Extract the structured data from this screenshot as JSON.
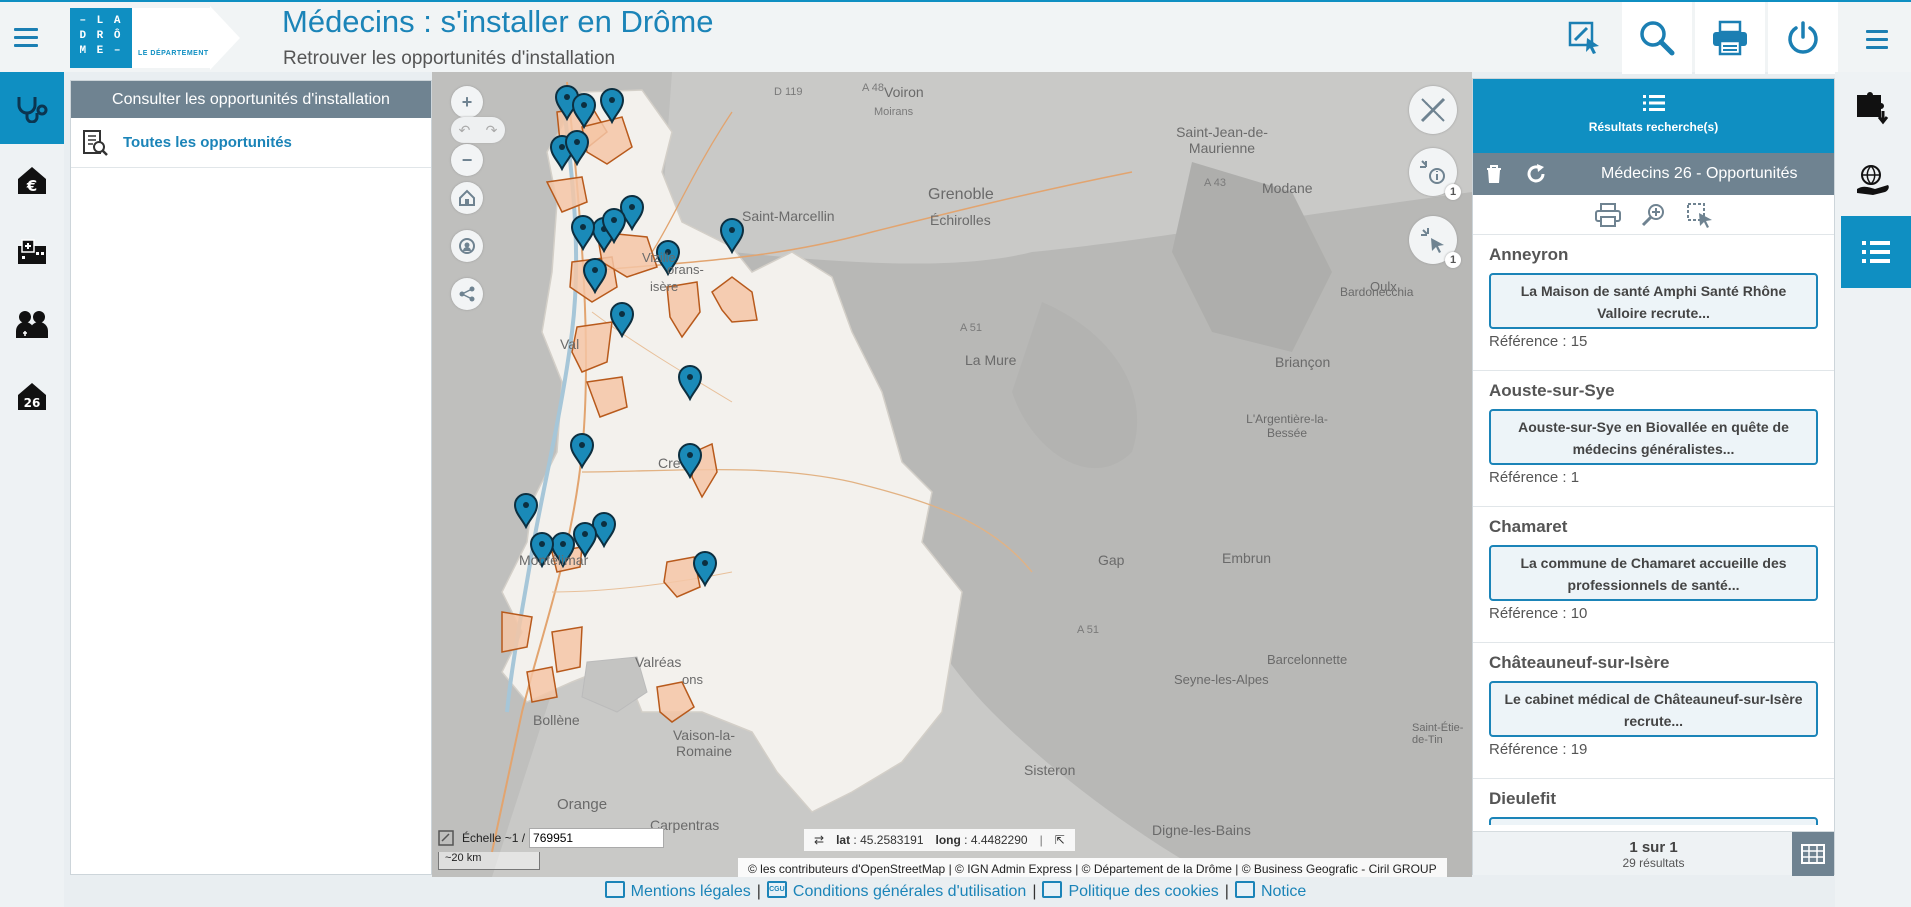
{
  "header": {
    "title": "Médecins : s'installer en Drôme",
    "subtitle": "Retrouver les opportunités d'installation",
    "logo_lines": [
      "– L A",
      "D R Ô",
      "M E –"
    ],
    "logo_caption": "LE DÉPARTEMENT"
  },
  "left_strip": {
    "items": [
      "doctor-icon",
      "euro-house-icon",
      "hospital-icon",
      "doctors-group-icon",
      "house-26-icon"
    ],
    "badge_26": "26"
  },
  "left_panel": {
    "header": "Consulter les opportunités d'installation",
    "items": [
      {
        "label": "Toutes les opportunités"
      }
    ]
  },
  "map": {
    "labels": [
      "D 119",
      "A 48",
      "Voiron",
      "Moirans",
      "Grenoble",
      "Échirolles",
      "Saint-Marcellin",
      "Vizille",
      "Saint-Jean-de-Maurienne",
      "Modane",
      "A 43",
      "Bardonecchia",
      "Oulx",
      "La Mure",
      "A 51",
      "Briançon",
      "L'Argentière-la-Bessée",
      "Cre",
      "Montélimar",
      "Gap",
      "Embrun",
      "A 51",
      "Valréas",
      "Bollène",
      "Vaison-la-Romaine",
      "Seyne-les-Alpes",
      "Barcelonnette",
      "Orange",
      "Carpentras",
      "Sisteron",
      "Digne-les-Bains",
      "Saint-Étie-de-Tin",
      "ons",
      "Val",
      "isère",
      "orans-"
    ],
    "scale_label": "Échelle ~1 /",
    "scale_value": "769951",
    "scalebar": "~20 km",
    "lat_label": "lat",
    "lat_value": "45.2583191",
    "long_label": "long",
    "long_value": "4.4482290",
    "attribution": "© les contributeurs d'OpenStreetMap | © IGN Admin Express | © Département de la Drôme | © Business Geografic - Ciril GROUP",
    "badges": [
      "1",
      "1"
    ],
    "zoom_in": "+",
    "zoom_out": "−"
  },
  "results": {
    "header": "Résultats recherche(s)",
    "layer_title": "Médecins 26 - Opportunités",
    "items": [
      {
        "commune": "Anneyron",
        "text": "La Maison de santé Amphi Santé Rhône Valloire recrute...",
        "reference": "Référence : 15"
      },
      {
        "commune": "Aouste-sur-Sye",
        "text": "Aouste-sur-Sye en Biovallée en quête de médecins généralistes...",
        "reference": "Référence : 1"
      },
      {
        "commune": "Chamaret",
        "text": "La commune de Chamaret accueille des professionnels de santé...",
        "reference": "Référence : 10"
      },
      {
        "commune": "Châteauneuf-sur-Isère",
        "text": "Le cabinet médical de Châteauneuf-sur-Isère recrute...",
        "reference": "Référence : 19"
      },
      {
        "commune": "Dieulefit",
        "text": "",
        "reference": ""
      }
    ],
    "pagination": "1 sur 1",
    "count": "29 résultats"
  },
  "footer": {
    "links": [
      "Mentions légales",
      "Conditions générales d'utilisation",
      "Politique des cookies",
      "Notice"
    ],
    "sep": "|",
    "cgu_icon_text": "CGU"
  },
  "colors": {
    "accent": "#0f8fc2",
    "title": "#1b84b8",
    "panel_header": "#6f8391",
    "marker": "#1a8ab8",
    "parcel_fill": "#f4c6a6",
    "parcel_stroke": "#b85a1c"
  }
}
